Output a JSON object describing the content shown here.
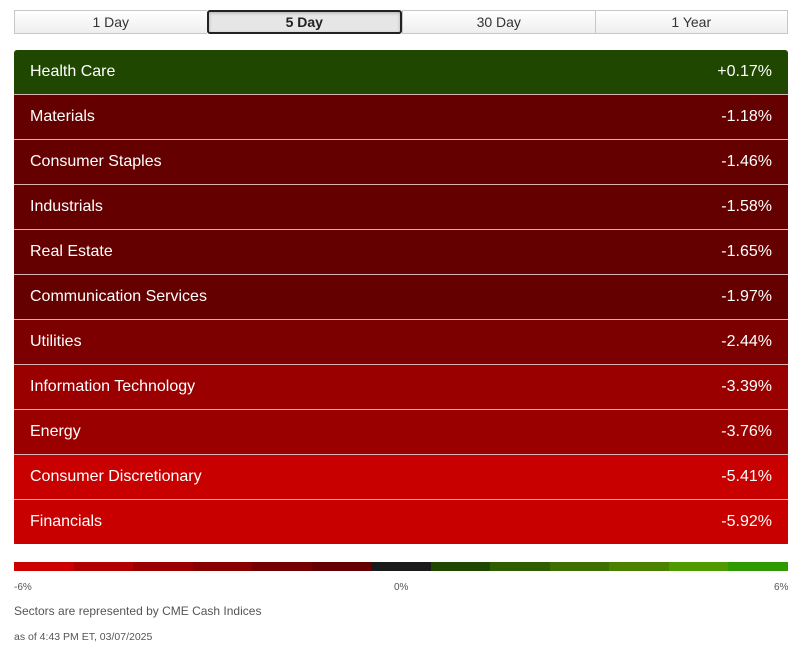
{
  "tabs": [
    {
      "label": "1 Day",
      "active": false
    },
    {
      "label": "5 Day",
      "active": true
    },
    {
      "label": "30 Day",
      "active": false
    },
    {
      "label": "1 Year",
      "active": false
    }
  ],
  "chart_data": {
    "type": "table",
    "value_unit": "%",
    "sectors": [
      {
        "name": "Health Care",
        "value": 0.17,
        "display": "+0.17%",
        "color": "#1f4700"
      },
      {
        "name": "Materials",
        "value": -1.18,
        "display": "-1.18%",
        "color": "#650000"
      },
      {
        "name": "Consumer Staples",
        "value": -1.46,
        "display": "-1.46%",
        "color": "#650000"
      },
      {
        "name": "Industrials",
        "value": -1.58,
        "display": "-1.58%",
        "color": "#650000"
      },
      {
        "name": "Real Estate",
        "value": -1.65,
        "display": "-1.65%",
        "color": "#650000"
      },
      {
        "name": "Communication Services",
        "value": -1.97,
        "display": "-1.97%",
        "color": "#650000"
      },
      {
        "name": "Utilities",
        "value": -2.44,
        "display": "-2.44%",
        "color": "#7d0000"
      },
      {
        "name": "Information Technology",
        "value": -3.39,
        "display": "-3.39%",
        "color": "#9a0000"
      },
      {
        "name": "Energy",
        "value": -3.76,
        "display": "-3.76%",
        "color": "#9a0000"
      },
      {
        "name": "Consumer Discretionary",
        "value": -5.41,
        "display": "-5.41%",
        "color": "#c80000"
      },
      {
        "name": "Financials",
        "value": -5.92,
        "display": "-5.92%",
        "color": "#c80000"
      }
    ],
    "color_scale": {
      "min": -6,
      "max": 6,
      "min_label": "-6%",
      "mid_label": "0%",
      "max_label": "6%",
      "colors": [
        "#cc0000",
        "#b00000",
        "#9a0000",
        "#880000",
        "#750000",
        "#650000",
        "#1a1a1a",
        "#1f4700",
        "#2e5e00",
        "#3d7000",
        "#4a8200",
        "#4e9a00",
        "#2f9a00"
      ]
    }
  },
  "footer": {
    "source": "Sectors are represented by CME Cash Indices",
    "timestamp": "as of 4:43 PM ET, 03/07/2025"
  }
}
